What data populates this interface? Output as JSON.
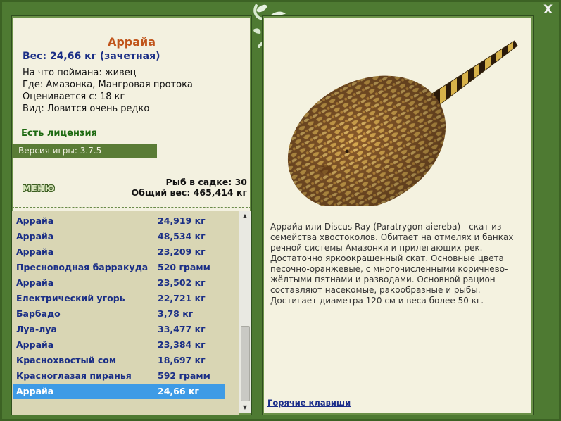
{
  "window": {
    "close_label": "X"
  },
  "fish": {
    "title": "Аррайа",
    "weight": "Вес: 24,66 кг (зачетная)",
    "info_lines": [
      "На что поймана: живец",
      "Где: Амазонка, Мангровая протока",
      "Оценивается с: 18 кг",
      "Вид: Ловится очень редко"
    ],
    "description": "Аррайа или Discus Ray (Paratrygon aiereba) - скат из семейства хвостоколов. Обитает на отмелях и банках речной системы Амазонки и прилегающих рек. Достаточно яркоокрашенный скат. Основные цвета песочно-оранжевые, с многочисленными коричнево-жёлтыми пятнами и разводами. Основной рацион составляют насекомые, ракообразные и рыбы. Достигает диаметра 120 см и веса более 50 кг."
  },
  "license_text": "Есть лицензия",
  "version_text": "Версия игры: 3.7.5",
  "menu_label": "МЕНЮ",
  "stats": {
    "fish_count": "Рыб в садке: 30",
    "total_weight": "Общий вес: 465,414 кг"
  },
  "catch_list": [
    {
      "name": "Аррайа",
      "weight": "24,919 кг"
    },
    {
      "name": "Аррайа",
      "weight": "48,534 кг"
    },
    {
      "name": "Аррайа",
      "weight": "23,209 кг"
    },
    {
      "name": "Пресноводная барракуда",
      "weight": "520 грамм"
    },
    {
      "name": "Аррайа",
      "weight": "23,502 кг"
    },
    {
      "name": "Електрический угорь",
      "weight": "22,721 кг"
    },
    {
      "name": "Барбадо",
      "weight": "3,78 кг"
    },
    {
      "name": "Луа-луа",
      "weight": "33,477 кг"
    },
    {
      "name": "Аррайа",
      "weight": "23,384 кг"
    },
    {
      "name": "Краснохвостый сом",
      "weight": "18,697 кг"
    },
    {
      "name": "Красноглазая пиранья",
      "weight": "592 грамм"
    },
    {
      "name": "Аррайа",
      "weight": "24,66 кг",
      "selected": true
    }
  ],
  "hotkeys_label": "Горячие клавиши",
  "colors": {
    "frame_green": "#4e7a32",
    "title_orange": "#c0541a",
    "link_blue": "#1b2f86",
    "selection_blue": "#3e9be6"
  },
  "icons": {
    "logo": "fishing-logo-icon",
    "fish_image": "stingray-image"
  }
}
